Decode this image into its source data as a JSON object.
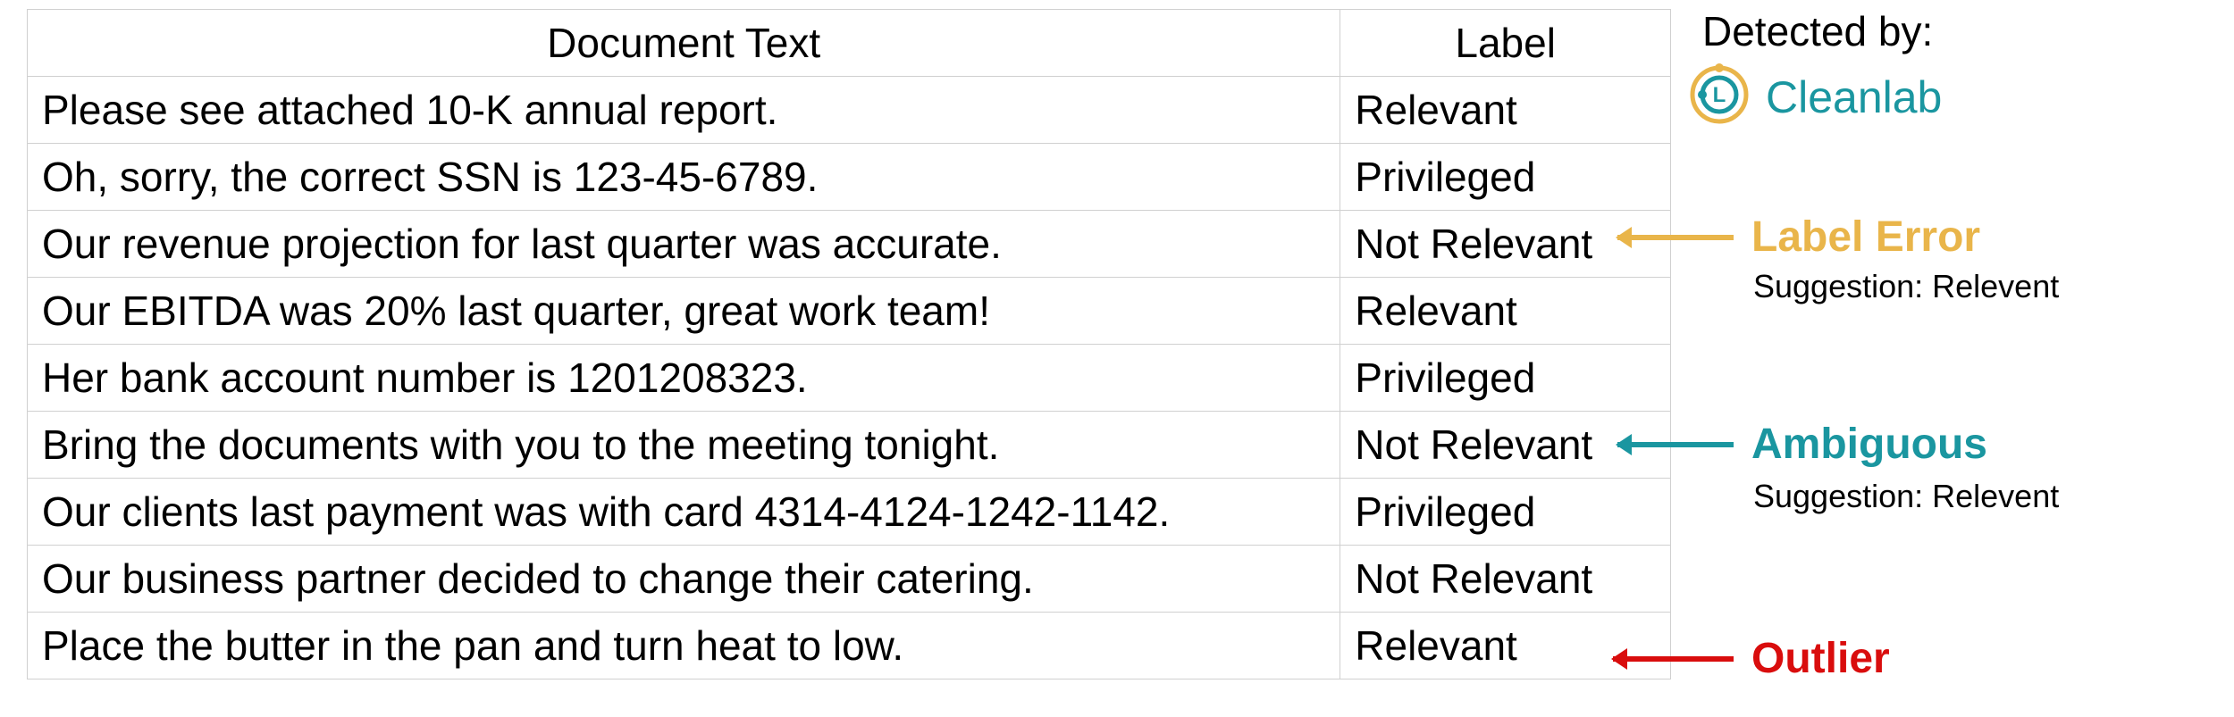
{
  "table": {
    "headers": {
      "col1": "Document Text",
      "col2": "Label"
    },
    "rows": [
      {
        "text": "Please see attached 10-K annual report.",
        "label": "Relevant"
      },
      {
        "text": "Oh, sorry, the correct SSN is 123-45-6789.",
        "label": "Privileged"
      },
      {
        "text": "Our revenue projection for last quarter was accurate.",
        "label": "Not Relevant"
      },
      {
        "text": "Our EBITDA was 20% last quarter, great work team!",
        "label": "Relevant"
      },
      {
        "text": "Her bank account number is 1201208323.",
        "label": "Privileged"
      },
      {
        "text": "Bring the documents with you to the meeting tonight.",
        "label": "Not Relevant"
      },
      {
        "text": "Our clients last payment was with card 4314-4124-1242-1142.",
        "label": "Privileged"
      },
      {
        "text": "Our business partner decided to change their catering.",
        "label": "Not Relevant"
      },
      {
        "text": "Place the butter in the pan and turn heat to low.",
        "label": "Relevant"
      }
    ]
  },
  "side": {
    "detectedBy": "Detected by:",
    "brand": "Cleanlab",
    "annotations": {
      "labelError": {
        "title": "Label Error",
        "suggestion": "Suggestion: Relevent"
      },
      "ambiguous": {
        "title": "Ambiguous",
        "suggestion": "Suggestion: Relevent"
      },
      "outlier": {
        "title": "Outlier"
      }
    }
  },
  "colors": {
    "orange": "#e9b54a",
    "teal": "#1a96a0",
    "red": "#d90d0d"
  }
}
